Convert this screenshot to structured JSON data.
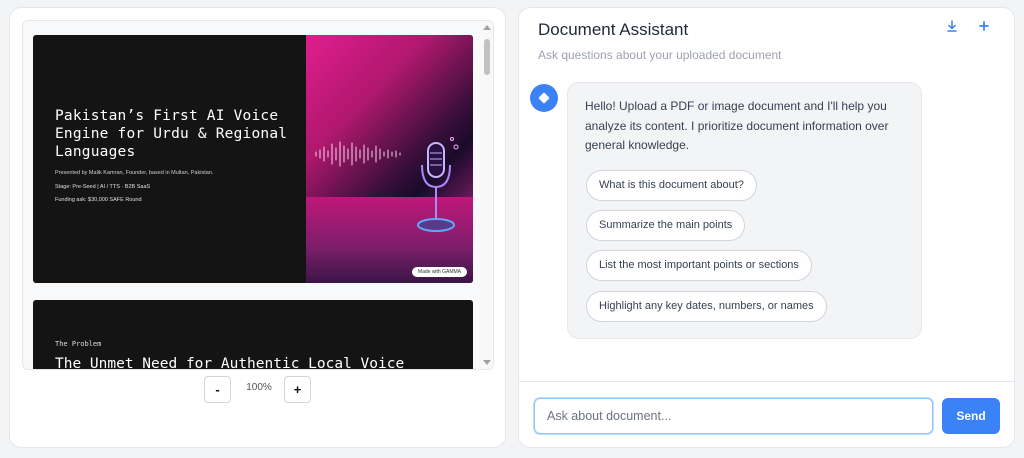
{
  "viewer": {
    "slides": [
      {
        "title": "Pakistan’s First AI Voice Engine for Urdu & Regional Languages",
        "presented_by": "Presented by Malik Kamran, Founder, based in Multan, Pakistan.",
        "stage": "Stage: Pre-Seed | AI / TTS · B2B SaaS",
        "funding": "Funding ask: $30,000 SAFE Round",
        "badge": "Made with GAMMA"
      },
      {
        "label": "The Problem",
        "title": "The Unmet Need for Authentic Local Voice"
      }
    ],
    "zoom": {
      "minus_label": "-",
      "level": "100%",
      "plus_label": "+"
    }
  },
  "assistant": {
    "title": "Document Assistant",
    "subtitle": "Ask questions about your uploaded document",
    "download_icon": "download-icon",
    "plus_icon": "plus-icon",
    "message": "Hello! Upload a PDF or image document and I'll help you analyze its content. I prioritize document information over general knowledge.",
    "suggestions": [
      "What is this document about?",
      "Summarize the main points",
      "List the most important points or sections",
      "Highlight any key dates, numbers, or names"
    ],
    "input_placeholder": "Ask about document...",
    "send_label": "Send"
  },
  "colors": {
    "accent": "#3b82f6",
    "slide_bg": "#141414",
    "slide_art": "#e11d8f"
  }
}
